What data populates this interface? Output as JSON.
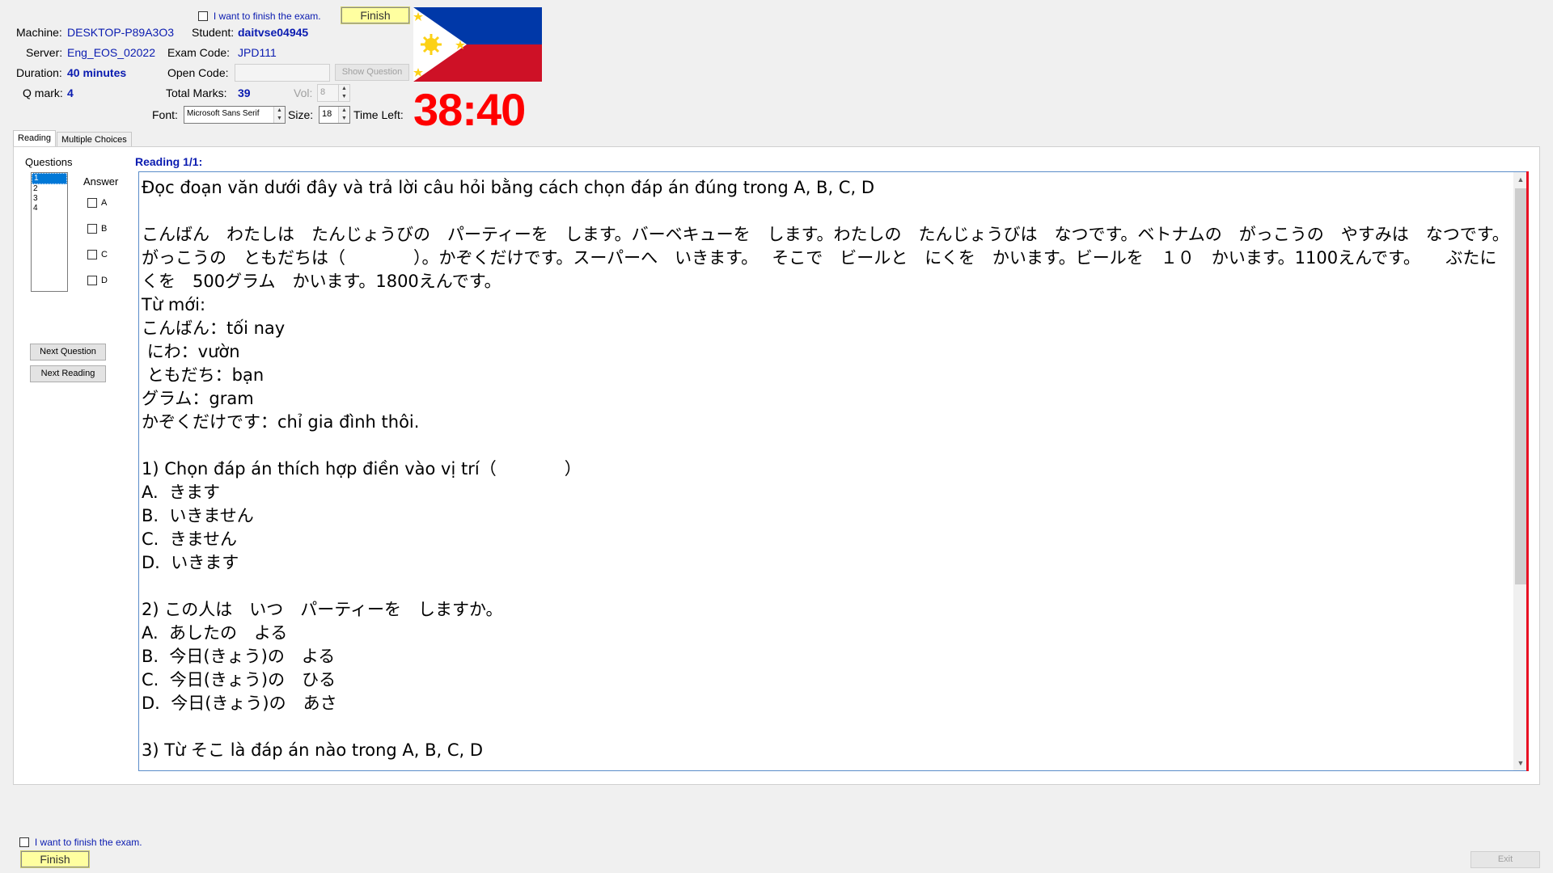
{
  "header": {
    "finish_check_label": "I want to finish the exam.",
    "finish_button": "Finish",
    "machine_label": "Machine:",
    "machine_value": "DESKTOP-P89A3O3",
    "student_label": "Student:",
    "student_value": "daitvse04945",
    "server_label": "Server:",
    "server_value": "Eng_EOS_02022",
    "exam_code_label": "Exam Code:",
    "exam_code_value": "JPD111",
    "duration_label": "Duration:",
    "duration_value": "40 minutes",
    "open_code_label": "Open Code:",
    "open_code_value": "",
    "show_question_button": "Show Question",
    "qmark_label": "Q mark:",
    "qmark_value": "4",
    "total_marks_label": "Total Marks:",
    "total_marks_value": "39",
    "vol_label": "Vol:",
    "vol_value": "8",
    "font_label": "Font:",
    "font_value": "Microsoft Sans Serif",
    "size_label": "Size:",
    "size_value": "18",
    "time_left_label": "Time Left:",
    "time_left_value": "38:40"
  },
  "tabs": [
    "Reading",
    "Multiple Choices"
  ],
  "left_panel": {
    "questions_label": "Questions",
    "questions": [
      "1",
      "2",
      "3",
      "4"
    ],
    "selected_question": "1",
    "answer_label": "Answer",
    "answers": [
      "A",
      "B",
      "C",
      "D"
    ],
    "next_question_button": "Next Question",
    "next_reading_button": "Next Reading"
  },
  "reading": {
    "heading": "Reading 1/1:",
    "text": "Đọc đoạn văn dưới đây và trả lời câu hỏi bằng cách chọn đáp án đúng trong A, B, C, D\n\nこんばん　わたしは　たんじょうびの　パーティーを　します。バーベキューを　します。わたしの　たんじょうびは　なつです。ベトナムの　がっこうの　やすみは　なつです。　 がっこうの　ともだちは（　　　　）。かぞくだけです。スーパーへ　いきます。　 そこで　ビールと　にくを　かいます。ビールを　１０　かいます。1100えんです。　　ぶたにくを　500グラム　かいます。1800えんです。\nTừ mới:\nこんばん：tối nay\n にわ：vườn\n ともだち：bạn\nグラム：gram\nかぞくだけです：chỉ gia đình thôi.\n\n1) Chọn đáp án thích hợp điền vào vị trí（　　　　）\nA.  きます\nB.  いきません\nC.  きません\nD.  いきます\n\n2) この人は　いつ　パーティーを　しますか。\nA.  あしたの　よる\nB.  今日(きょう)の　よる\nC.  今日(きょう)の　ひる\nD.  今日(きょう)の　あさ\n\n3) Từ そこ là đáp án nào trong A, B, C, D"
  },
  "footer": {
    "finish_check_label": "I want to finish the exam.",
    "finish_button": "Finish",
    "exit_button": "Exit"
  },
  "colors": {
    "value_blue": "#0a1bb0",
    "timer_red": "#ff0000",
    "finish_yellow": "#ffffa0",
    "flag_blue": "#0038a8",
    "flag_red": "#ce1126",
    "flag_sun": "#fcd116"
  }
}
